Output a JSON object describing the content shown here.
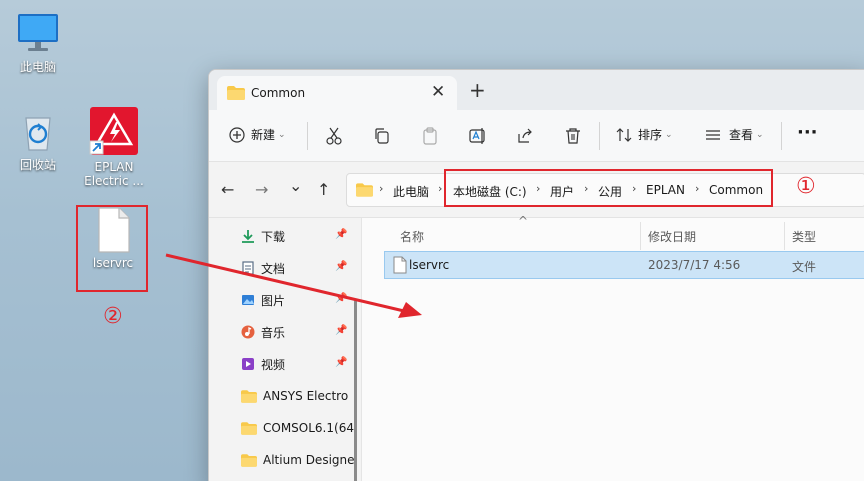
{
  "desktop": {
    "icons": [
      {
        "label": "此电脑",
        "icon": "monitor-icon"
      },
      {
        "label": "回收站",
        "icon": "recycle-bin-icon"
      },
      {
        "label": "EPLAN Electric ...",
        "label_line1": "EPLAN",
        "label_line2": "Electric ...",
        "icon": "eplan-app-icon"
      },
      {
        "label": "lservrc",
        "icon": "file-icon"
      }
    ]
  },
  "annotations": {
    "num1": "①",
    "num2": "②",
    "color": "#e0262d"
  },
  "window": {
    "tab": {
      "title": "Common",
      "close": "✕"
    },
    "new_tab": "+",
    "toolbar": {
      "new_label": "新建",
      "sort_label": "排序",
      "view_label": "查看",
      "more_label": "···",
      "icons": [
        "cut-icon",
        "copy-icon",
        "paste-icon",
        "rename-icon",
        "share-icon",
        "delete-icon"
      ]
    },
    "nav": {
      "back": "←",
      "forward": "→",
      "recent": "⌄",
      "up": "↑",
      "breadcrumbs": [
        "此电脑",
        "本地磁盘 (C:)",
        "用户",
        "公用",
        "EPLAN",
        "Common"
      ],
      "sep": "›"
    },
    "sidebar": {
      "items": [
        {
          "label": "下载",
          "icon": "download-icon",
          "pinned": true
        },
        {
          "label": "文档",
          "icon": "documents-icon",
          "pinned": true
        },
        {
          "label": "图片",
          "icon": "pictures-icon",
          "pinned": true
        },
        {
          "label": "音乐",
          "icon": "music-icon",
          "pinned": true
        },
        {
          "label": "视频",
          "icon": "videos-icon",
          "pinned": true
        },
        {
          "label": "ANSYS Electro",
          "icon": "folder-icon",
          "pinned": false
        },
        {
          "label": "COMSOL6.1(64",
          "icon": "folder-icon",
          "pinned": false
        },
        {
          "label": "Altium Designe",
          "icon": "folder-icon",
          "pinned": false
        }
      ],
      "pin_glyph": "📌"
    },
    "files": {
      "columns": {
        "name": "名称",
        "date": "修改日期",
        "type": "类型"
      },
      "sort_indicator": "^",
      "rows": [
        {
          "name": "lservrc",
          "date": "2023/7/17 4:56",
          "type": "文件",
          "selected": true
        }
      ]
    }
  },
  "colors": {
    "accent_selection": "#cce4f7",
    "folder_yellow": "#f8c94a",
    "eplan_red": "#e2162e",
    "annotation_red": "#e0262d"
  }
}
